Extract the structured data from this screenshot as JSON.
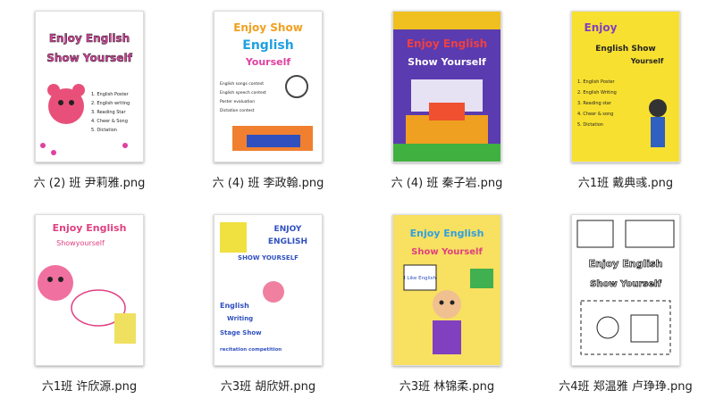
{
  "files": [
    {
      "name": "六 (2) 班  尹莉雅.png",
      "poster": {
        "title1": "Enjoy English",
        "title2": "Show Yourself",
        "lines": [
          "1. English Poster",
          "2. English writing",
          "3. Reading Star",
          "4. Cheer & Song",
          "5. Dictation"
        ]
      }
    },
    {
      "name": "六 (4) 班  李政翰.png",
      "poster": {
        "title1": "Enjoy Show",
        "title2": "English",
        "title3": "Yourself",
        "lines": [
          "English songs contest",
          "English speech contest",
          "Poster evaluation",
          "Dictation contest"
        ]
      }
    },
    {
      "name": "六 (4) 班  秦子岩.png",
      "poster": {
        "title1": "Enjoy English",
        "title2": "Show Yourself"
      }
    },
    {
      "name": "六1班 戴典彧.png",
      "poster": {
        "title1": "Enjoy",
        "title2": "English Show",
        "title3": "Yourself",
        "lines": [
          "1. English Poster",
          "2. English Writing",
          "3. Reading star",
          "4. Cheer & song",
          "5. Dictation"
        ]
      }
    },
    {
      "name": "六1班 许欣源.png",
      "poster": {
        "title1": "Enjoy English",
        "title2": "Showyourself"
      }
    },
    {
      "name": "六3班 胡欣妍.png",
      "poster": {
        "title1": "ENJOY",
        "title2": "ENGLISH",
        "title3": "SHOW YOURSELF",
        "lines": [
          "English",
          "Writing",
          "Stage Show",
          "recitation competition"
        ]
      }
    },
    {
      "name": "六3班 林锦柔.png",
      "poster": {
        "title1": "Enjoy English",
        "title2": "Show Yourself",
        "lines": [
          "I Like English"
        ]
      }
    },
    {
      "name": "六4班 郑温雅  卢琤琤.png",
      "poster": {
        "title1": "Enjoy English",
        "title2": "Show Yourself"
      }
    }
  ],
  "colors": {
    "background": "#ffffff",
    "caption": "#222222",
    "shadow": "#cccccc"
  }
}
